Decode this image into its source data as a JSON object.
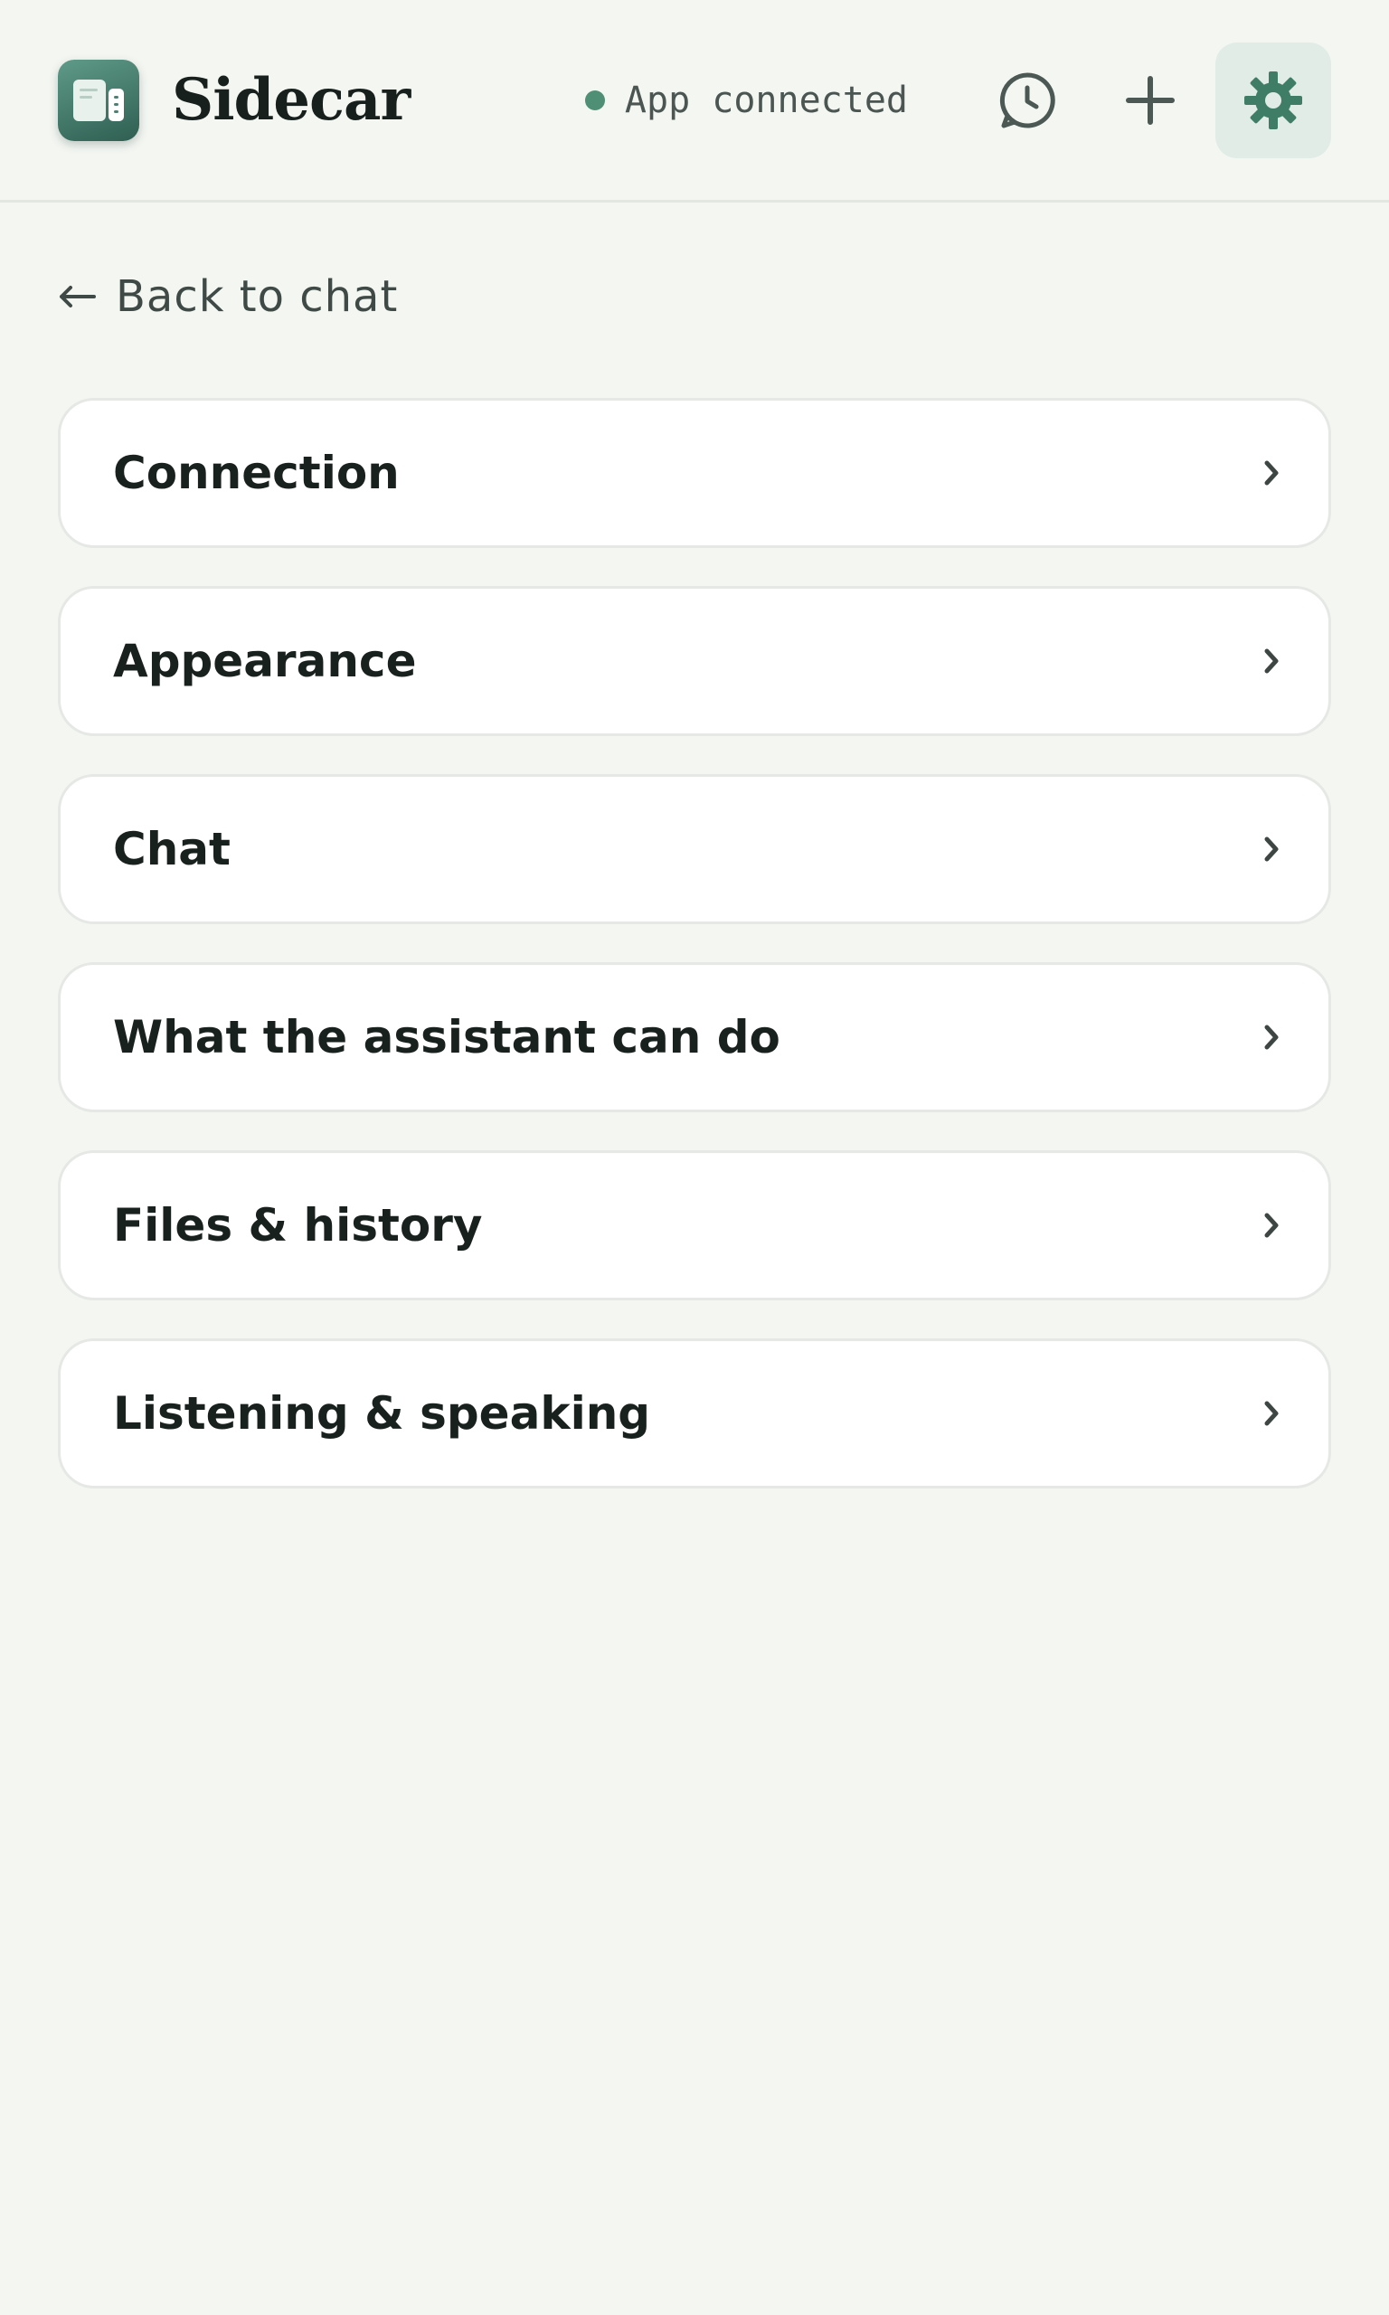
{
  "header": {
    "app_title": "Sidecar",
    "status_text": "App connected",
    "status_color": "#4f8f76",
    "icons": [
      "app-logo-icon",
      "history-icon",
      "plus-icon",
      "gear-icon"
    ]
  },
  "back": {
    "label": "Back to chat",
    "icon": "arrow-left-icon"
  },
  "settings": {
    "items": [
      {
        "label": "Connection"
      },
      {
        "label": "Appearance"
      },
      {
        "label": "Chat"
      },
      {
        "label": "What the assistant can do"
      },
      {
        "label": "Files & history"
      },
      {
        "label": "Listening & speaking"
      }
    ],
    "chevron_icon": "chevron-right-icon"
  },
  "colors": {
    "background": "#f4f6f2",
    "accent": "#3f7d66",
    "active_button_bg": "#e1ece6"
  }
}
